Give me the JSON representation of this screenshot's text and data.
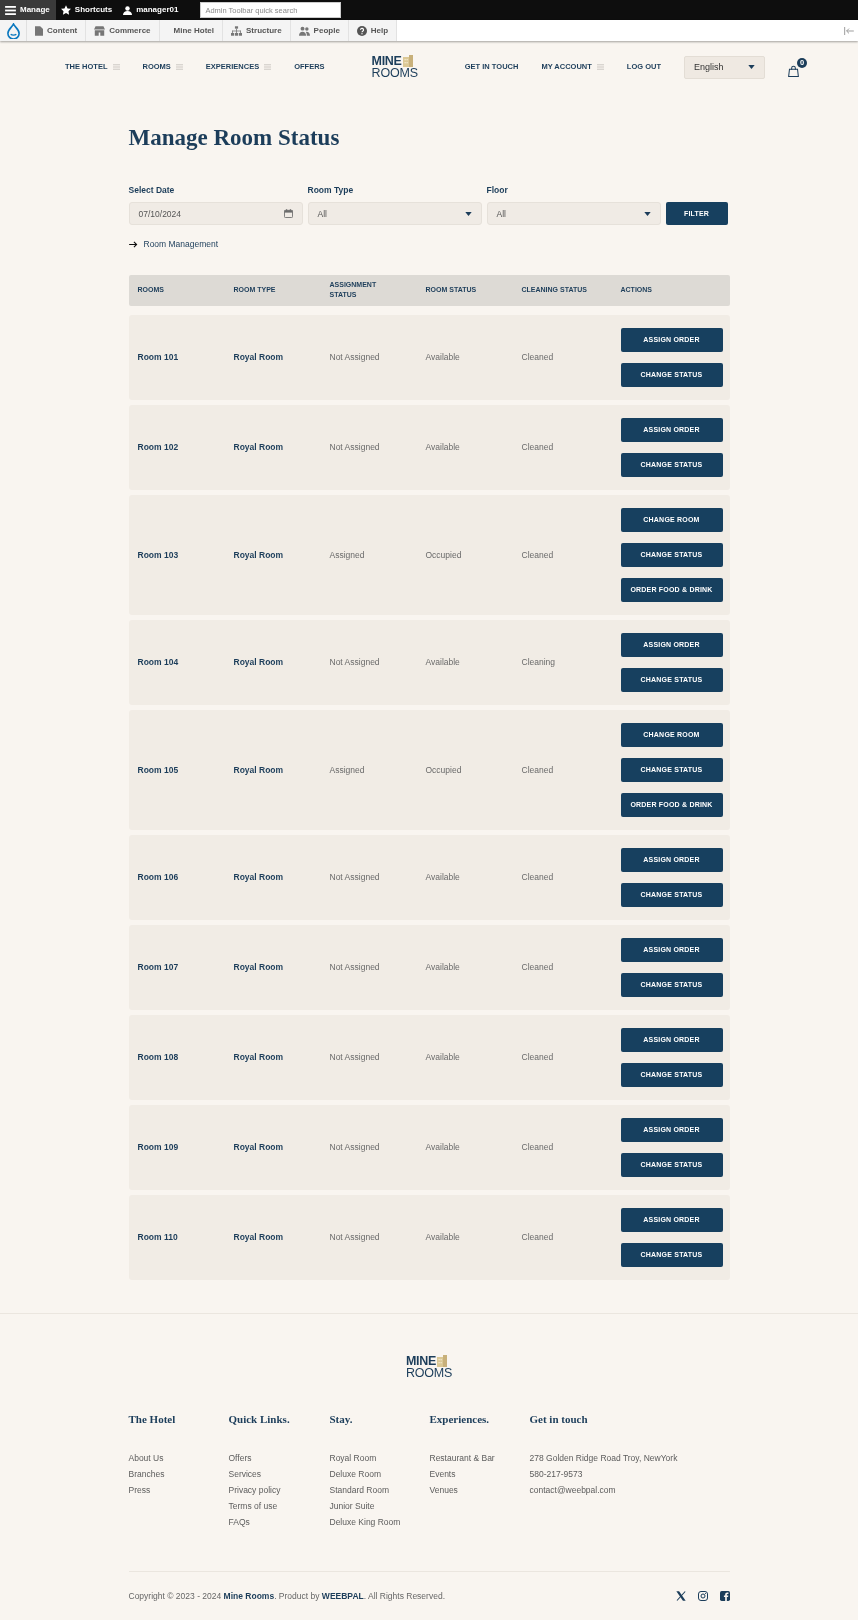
{
  "admin_toolbar": {
    "tabs": [
      {
        "label": "Manage",
        "selected": true
      },
      {
        "label": "Shortcuts",
        "selected": false
      },
      {
        "label": "manager01",
        "selected": false
      }
    ],
    "search": {
      "placeholder": "Admin Toolbar quick search"
    }
  },
  "admin_menu": {
    "items": [
      "Content",
      "Commerce",
      "Mine Hotel",
      "Structure",
      "People",
      "Help"
    ]
  },
  "site_nav": {
    "left_links": [
      {
        "label": "THE HOTEL",
        "has_submenu": true
      },
      {
        "label": "ROOMS",
        "has_submenu": true
      },
      {
        "label": "EXPERIENCES",
        "has_submenu": true
      },
      {
        "label": "OFFERS",
        "has_submenu": false
      }
    ],
    "logo": {
      "line_1": "MINE",
      "line_2": "ROOMS"
    },
    "right_links": [
      {
        "label": "GET IN TOUCH",
        "has_submenu": false
      },
      {
        "label": "MY ACCOUNT",
        "has_submenu": true
      },
      {
        "label": "LOG OUT",
        "has_submenu": false
      }
    ],
    "language": {
      "value": "English"
    },
    "cart": {
      "count": "0"
    }
  },
  "page": {
    "title": "Manage Room Status",
    "filters": [
      {
        "kind": "date",
        "label": "Select Date",
        "value": "07/10/2024"
      },
      {
        "kind": "select",
        "label": "Room Type",
        "value": "All"
      },
      {
        "kind": "select",
        "label": "Floor",
        "value": "All"
      }
    ],
    "filter_button": "FILTER",
    "back_link": "Room Management"
  },
  "table": {
    "columns": [
      "ROOMS",
      "ROOM TYPE",
      "ASSIGNMENT STATUS",
      "ROOM STATUS",
      "CLEANING STATUS",
      "ACTIONS"
    ],
    "rows": [
      {
        "room": "Room 101",
        "room_type": "Royal Room",
        "assignment_status": "Not Assigned",
        "room_status": "Available",
        "cleaning_status": "Cleaned",
        "actions": [
          "ASSIGN ORDER",
          "CHANGE STATUS"
        ]
      },
      {
        "room": "Room 102",
        "room_type": "Royal Room",
        "assignment_status": "Not Assigned",
        "room_status": "Available",
        "cleaning_status": "Cleaned",
        "actions": [
          "ASSIGN ORDER",
          "CHANGE STATUS"
        ]
      },
      {
        "room": "Room 103",
        "room_type": "Royal Room",
        "assignment_status": "Assigned",
        "room_status": "Occupied",
        "cleaning_status": "Cleaned",
        "actions": [
          "CHANGE ROOM",
          "CHANGE STATUS",
          "ORDER FOOD & DRINK"
        ]
      },
      {
        "room": "Room 104",
        "room_type": "Royal Room",
        "assignment_status": "Not Assigned",
        "room_status": "Available",
        "cleaning_status": "Cleaning",
        "actions": [
          "ASSIGN ORDER",
          "CHANGE STATUS"
        ]
      },
      {
        "room": "Room 105",
        "room_type": "Royal Room",
        "assignment_status": "Assigned",
        "room_status": "Occupied",
        "cleaning_status": "Cleaned",
        "actions": [
          "CHANGE ROOM",
          "CHANGE STATUS",
          "ORDER FOOD & DRINK"
        ]
      },
      {
        "room": "Room 106",
        "room_type": "Royal Room",
        "assignment_status": "Not Assigned",
        "room_status": "Available",
        "cleaning_status": "Cleaned",
        "actions": [
          "ASSIGN ORDER",
          "CHANGE STATUS"
        ]
      },
      {
        "room": "Room 107",
        "room_type": "Royal Room",
        "assignment_status": "Not Assigned",
        "room_status": "Available",
        "cleaning_status": "Cleaned",
        "actions": [
          "ASSIGN ORDER",
          "CHANGE STATUS"
        ]
      },
      {
        "room": "Room 108",
        "room_type": "Royal Room",
        "assignment_status": "Not Assigned",
        "room_status": "Available",
        "cleaning_status": "Cleaned",
        "actions": [
          "ASSIGN ORDER",
          "CHANGE STATUS"
        ]
      },
      {
        "room": "Room 109",
        "room_type": "Royal Room",
        "assignment_status": "Not Assigned",
        "room_status": "Available",
        "cleaning_status": "Cleaned",
        "actions": [
          "ASSIGN ORDER",
          "CHANGE STATUS"
        ]
      },
      {
        "room": "Room 110",
        "room_type": "Royal Room",
        "assignment_status": "Not Assigned",
        "room_status": "Available",
        "cleaning_status": "Cleaned",
        "actions": [
          "ASSIGN ORDER",
          "CHANGE STATUS"
        ]
      }
    ]
  },
  "footer": {
    "logo": {
      "line_1": "MINE",
      "line_2": "ROOMS"
    },
    "columns": [
      {
        "heading": "The Hotel",
        "links": [
          "About Us",
          "Branches",
          "Press"
        ]
      },
      {
        "heading": "Quick Links.",
        "links": [
          "Offers",
          "Services",
          "Privacy policy",
          "Terms of use",
          "FAQs"
        ]
      },
      {
        "heading": "Stay.",
        "links": [
          "Royal Room",
          "Deluxe Room",
          "Standard Room",
          "Junior Suite",
          "Deluxe King Room"
        ]
      },
      {
        "heading": "Experiences.",
        "links": [
          "Restaurant & Bar",
          "Events",
          "Venues"
        ]
      },
      {
        "heading": "Get in touch",
        "links": [
          "278 Golden Ridge Road Troy, NewYork",
          "580-217-9573",
          "contact@weebpal.com"
        ]
      }
    ],
    "copyright": "Copyright © 2023 - 2024 **Mine Rooms**. Product by **WEEBPAL**. All Rights Reserved."
  }
}
